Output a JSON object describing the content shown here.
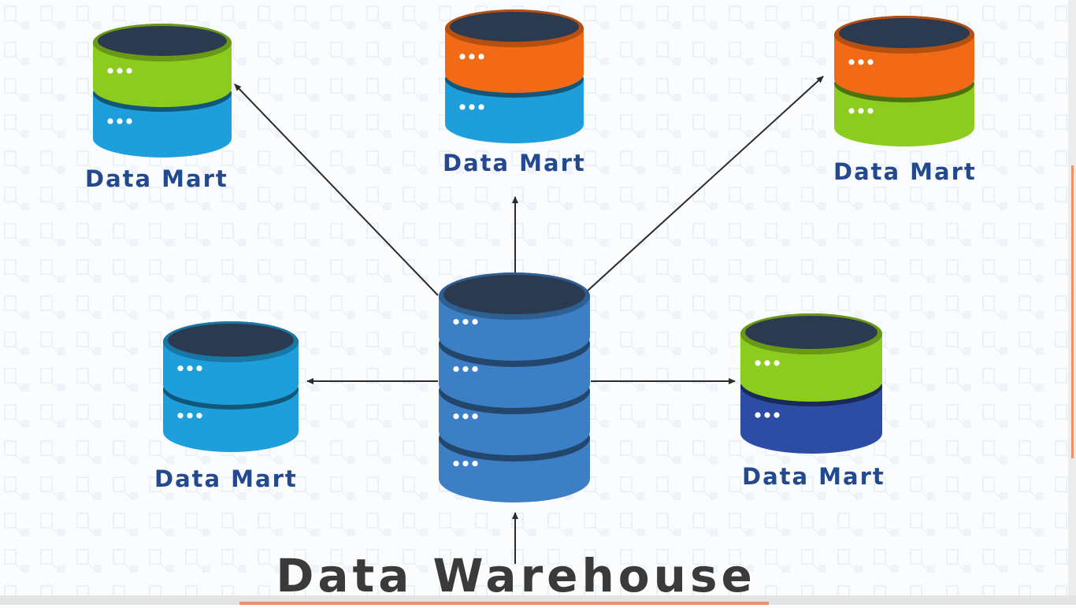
{
  "diagram": {
    "title": "Data Warehouse",
    "marts": [
      {
        "id": "top-left",
        "label": "Data Mart",
        "layers": [
          "green",
          "blue"
        ]
      },
      {
        "id": "top-center",
        "label": "Data Mart",
        "layers": [
          "orange",
          "blue"
        ]
      },
      {
        "id": "top-right",
        "label": "Data Mart",
        "layers": [
          "orange",
          "green"
        ]
      },
      {
        "id": "middle-left",
        "label": "Data Mart",
        "layers": [
          "blue",
          "blue"
        ]
      },
      {
        "id": "middle-right",
        "label": "Data Mart",
        "layers": [
          "green",
          "navy"
        ]
      }
    ],
    "warehouse_layers": 4,
    "colors": {
      "label_text": "#23498f",
      "title_text": "#3a3a3a",
      "cap_top": "#2c3a4f",
      "green": "#8ccc1e",
      "blue": "#1e9fdc",
      "orange": "#f26a16",
      "navy": "#2c4da3",
      "warehouse": "#3d7fc4",
      "arrow": "#2b2b2b"
    }
  }
}
